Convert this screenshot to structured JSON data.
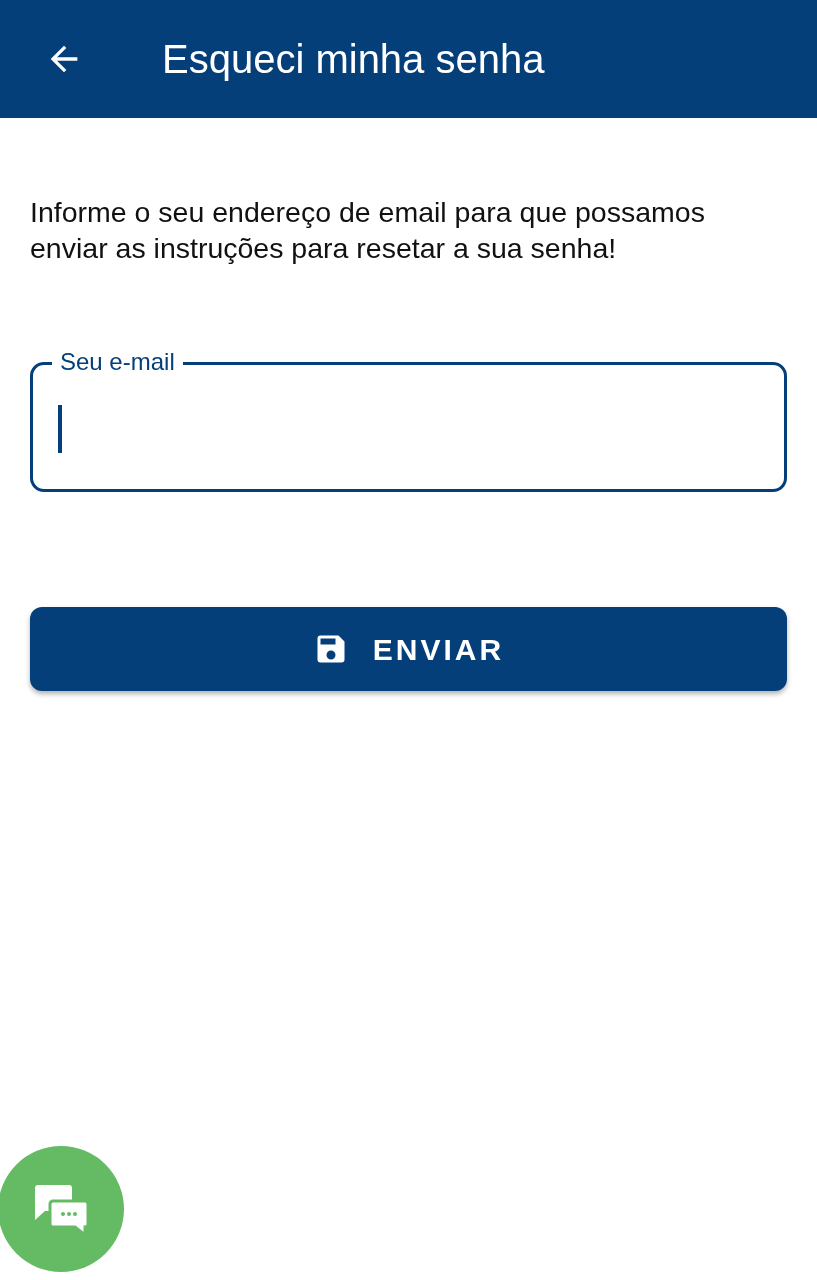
{
  "header": {
    "title": "Esqueci minha senha"
  },
  "instructions": "Informe o seu endereço de email para que possamos enviar as instruções para resetar a sua senha!",
  "email_field": {
    "label": "Seu e-mail",
    "focused": true
  },
  "submit_button": {
    "label": "ENVIAR"
  }
}
